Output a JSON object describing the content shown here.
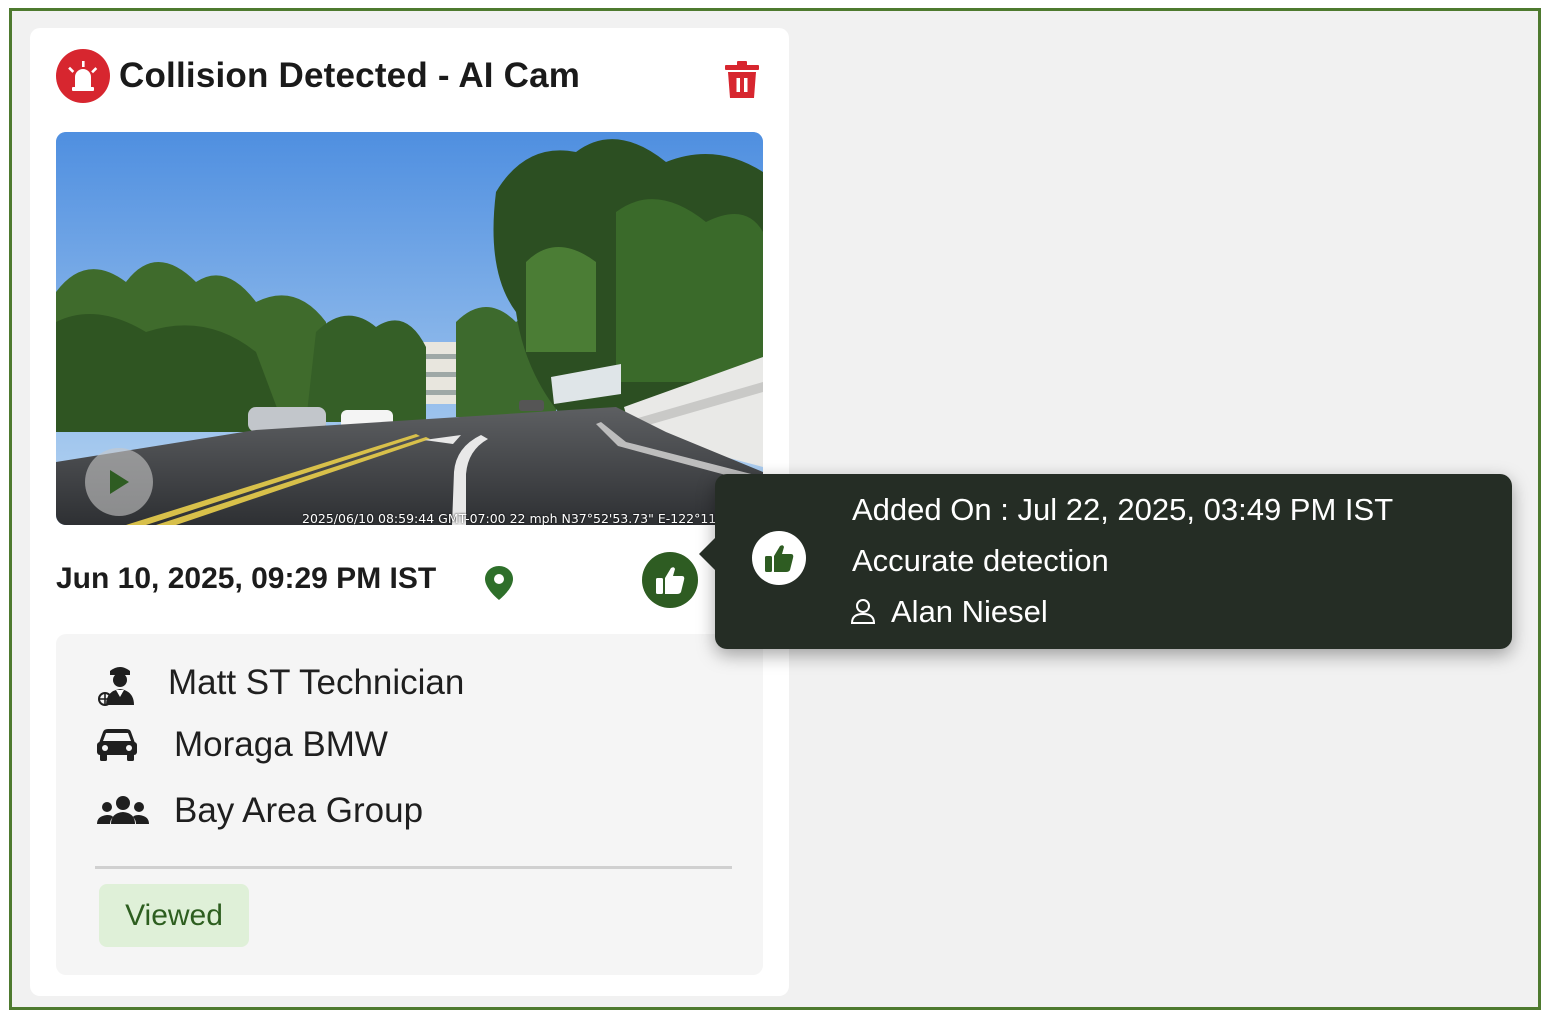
{
  "card": {
    "title": "Collision Detected - AI Cam",
    "video_overlay_text": "2025/06/10 08:59:44 GMT-07:00  22 mph   N37°52'53.73\"  E-122°11",
    "event_datetime": "Jun 10, 2025, 09:29 PM IST",
    "details": {
      "driver": "Matt ST Technician",
      "vehicle": "Moraga BMW",
      "group": "Bay Area Group"
    },
    "status": "Viewed"
  },
  "tooltip": {
    "added_on_label": "Added On :",
    "added_on_value": "Jul 22, 2025, 03:49 PM IST",
    "feedback": "Accurate detection",
    "user": "Alan Niesel"
  },
  "colors": {
    "frame_border": "#4e7a2f",
    "alarm_red": "#d7262f",
    "accent_green": "#2e5c22",
    "tooltip_bg": "#252d25",
    "badge_bg": "#dff0d8"
  },
  "icons": [
    "siren-icon",
    "trash-icon",
    "play-icon",
    "location-pin-icon",
    "thumbs-up-icon",
    "driver-icon",
    "car-icon",
    "group-icon",
    "user-icon"
  ]
}
